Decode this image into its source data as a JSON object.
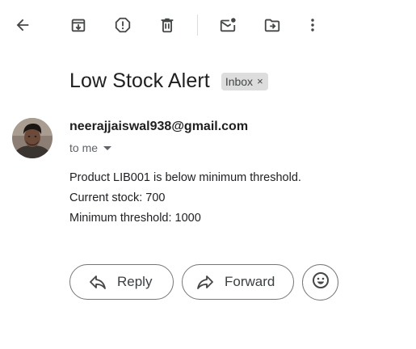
{
  "toolbar": {
    "icons": [
      "back-icon",
      "archive-icon",
      "report-spam-icon",
      "delete-icon",
      "mark-unread-icon",
      "move-to-icon",
      "more-options-icon"
    ]
  },
  "email": {
    "subject": "Low Stock Alert",
    "label": "Inbox",
    "label_remove": "×",
    "sender": "neerajjaiswal938@gmail.com",
    "recipient": "to me",
    "body": [
      "Product LIB001 is below minimum threshold.",
      "Current stock: 700",
      "Minimum threshold: 1000"
    ]
  },
  "actions": {
    "reply_label": "Reply",
    "forward_label": "Forward"
  },
  "colors": {
    "icon": "#444746",
    "chip": "#dddddd",
    "border": "#747775"
  }
}
